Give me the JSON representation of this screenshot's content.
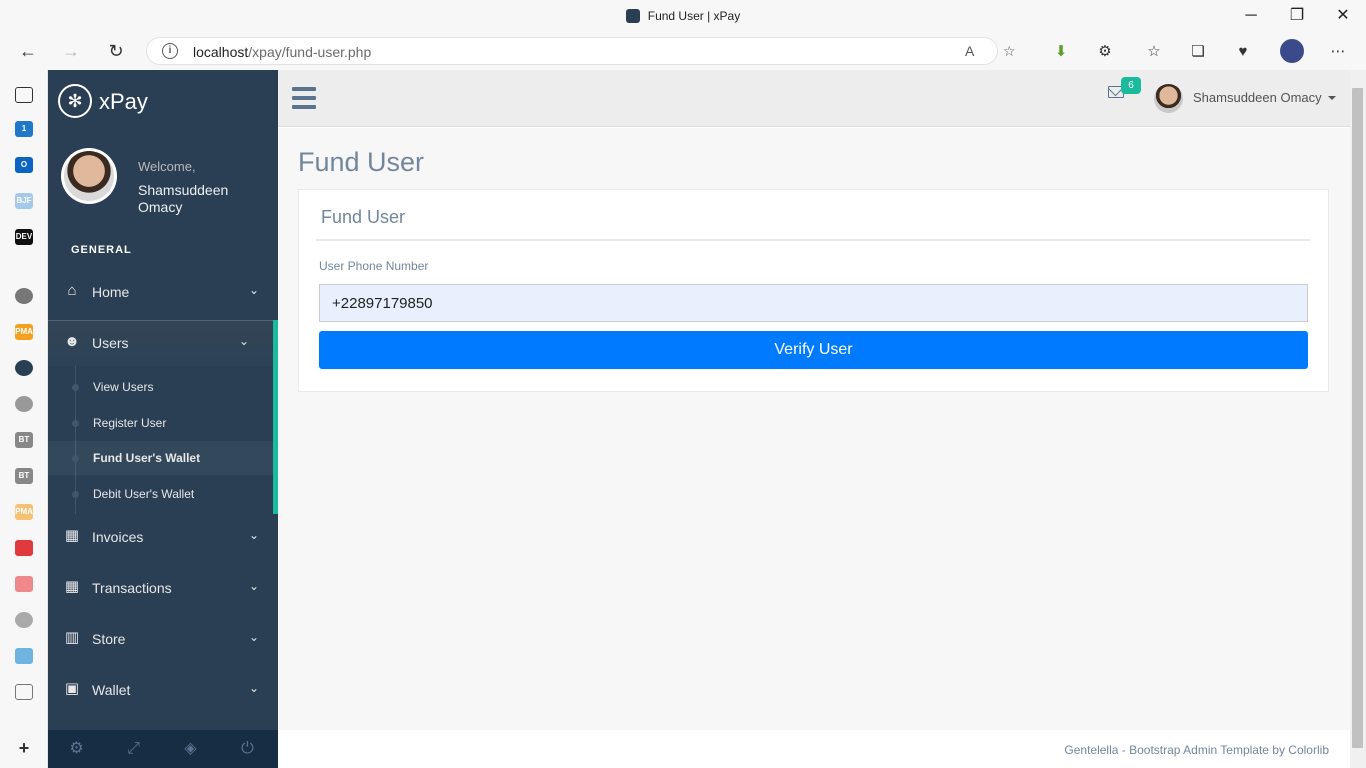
{
  "browser": {
    "tab_title": "Fund User | xPay",
    "url_host": "localhost",
    "url_path": "/xpay/fund-user.php"
  },
  "sidebar": {
    "brand": "xPay",
    "welcome": "Welcome,",
    "user_name": "Shamsuddeen Omacy",
    "section": "GENERAL",
    "menu": [
      {
        "label": "Home",
        "icon": "home-icon"
      },
      {
        "label": "Users",
        "icon": "users-icon"
      },
      {
        "label": "Invoices",
        "icon": "table-icon"
      },
      {
        "label": "Transactions",
        "icon": "table-icon"
      },
      {
        "label": "Store",
        "icon": "building-icon"
      },
      {
        "label": "Wallet",
        "icon": "money-icon"
      }
    ],
    "users_submenu": [
      {
        "label": "View Users"
      },
      {
        "label": "Register User"
      },
      {
        "label": "Fund User's Wallet"
      },
      {
        "label": "Debit User's Wallet"
      }
    ]
  },
  "topnav": {
    "mail_count": "6",
    "user_name": "Shamsuddeen Omacy"
  },
  "main": {
    "page_title": "Fund User",
    "panel_title": "Fund User",
    "field_label": "User Phone Number",
    "phone_value": "+22897179850",
    "verify_label": "Verify User"
  },
  "footer": {
    "text": "Gentelella - Bootstrap Admin Template by Colorlib"
  },
  "colors": {
    "sidebar_bg": "#2a3f54",
    "accent": "#1abb9c",
    "primary_button": "#007bff"
  }
}
